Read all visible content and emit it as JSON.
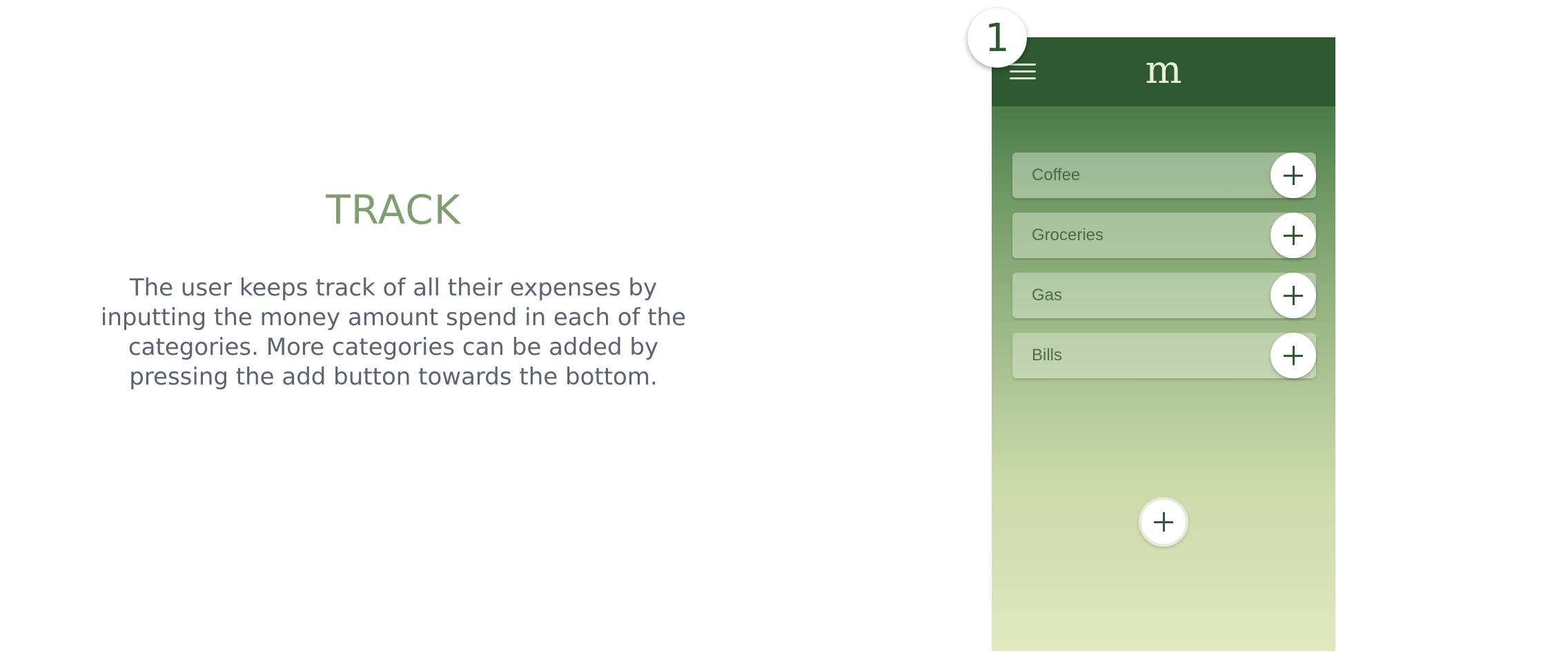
{
  "slide": {
    "title": "TRACK",
    "description": "The user keeps track of all their expenses by inputting the money amount spend in each of the categories. More categories can be added by pressing the add button towards the bottom."
  },
  "step_badge": "1",
  "app": {
    "logo": "m",
    "menu_icon": "hamburger-menu-icon",
    "categories": [
      {
        "label": "Coffee"
      },
      {
        "label": "Groceries"
      },
      {
        "label": "Gas"
      },
      {
        "label": "Bills"
      }
    ],
    "add_icon": "plus-icon"
  },
  "colors": {
    "title": "#7f9e72",
    "body_text": "#5b6470",
    "appbar": "#2f5a31",
    "accent": "#2f5a31",
    "gradient_top": "#3d7240",
    "gradient_bottom": "#e1e8c1"
  }
}
